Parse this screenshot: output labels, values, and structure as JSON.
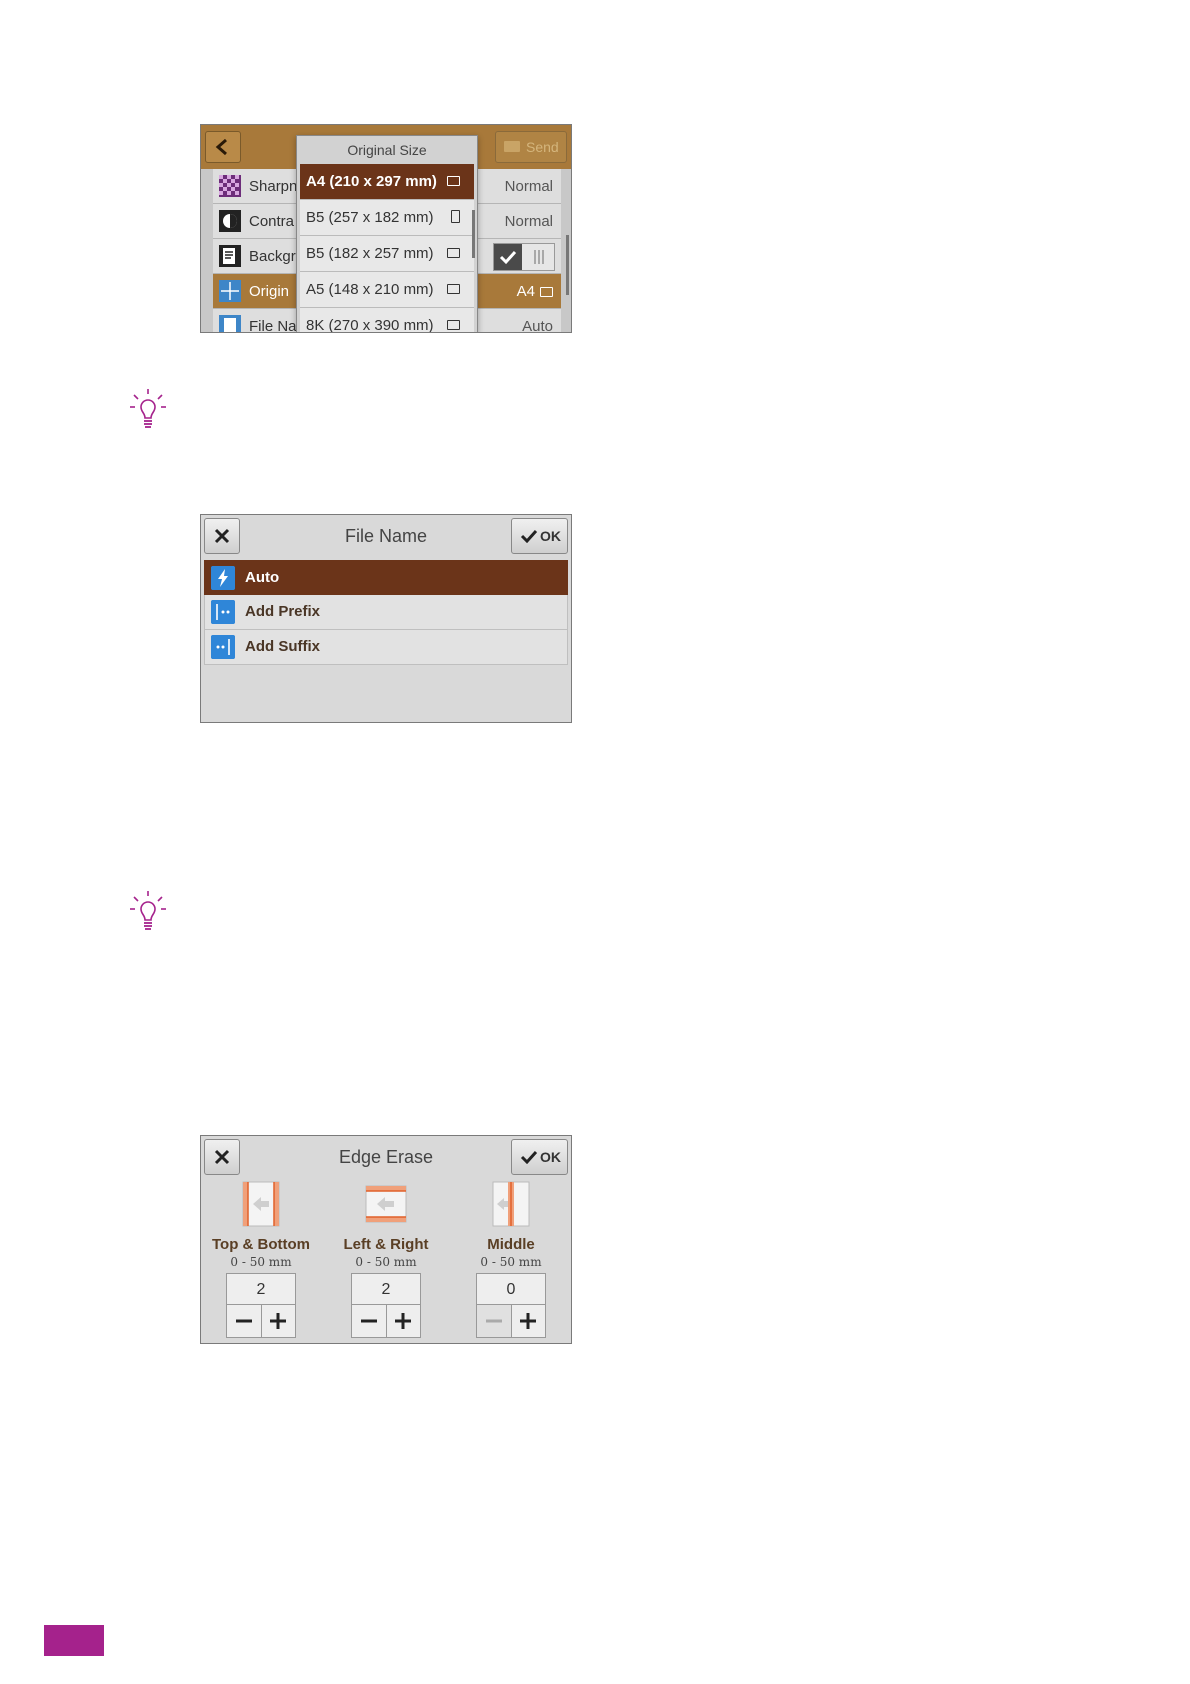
{
  "original_size_screen": {
    "header": {
      "send_label": "Send"
    },
    "rows": [
      {
        "label": "Sharpn",
        "value": "Normal",
        "icon": "checker-icon"
      },
      {
        "label": "Contra",
        "value": "Normal",
        "icon": "contrast-icon"
      },
      {
        "label": "Backgr",
        "value": "",
        "icon": "document-icon"
      },
      {
        "label": "Origin",
        "value": "A4",
        "icon": "crop-icon"
      },
      {
        "label": "File Name",
        "value": "Auto",
        "icon": "file-icon"
      }
    ],
    "popup": {
      "title": "Original Size",
      "options": [
        {
          "label": "A4 (210 x 297 mm)",
          "orientation": "landscape"
        },
        {
          "label": "B5 (257 x 182 mm)",
          "orientation": "portrait"
        },
        {
          "label": "B5 (182 x 257 mm)",
          "orientation": "landscape"
        },
        {
          "label": "A5 (148 x 210 mm)",
          "orientation": "landscape"
        },
        {
          "label": "8K (270 x 390 mm)",
          "orientation": "landscape"
        }
      ]
    }
  },
  "file_name_screen": {
    "title": "File Name",
    "ok_label": "OK",
    "items": [
      {
        "label": "Auto"
      },
      {
        "label": "Add Prefix"
      },
      {
        "label": "Add Suffix"
      }
    ]
  },
  "edge_erase_screen": {
    "title": "Edge Erase",
    "ok_label": "OK",
    "columns": [
      {
        "name": "Top & Bottom",
        "range": "0 - 50 mm",
        "value": "2"
      },
      {
        "name": "Left & Right",
        "range": "0 - 50 mm",
        "value": "2"
      },
      {
        "name": "Middle",
        "range": "0 - 50 mm",
        "value": "0"
      }
    ]
  },
  "colors": {
    "accent_brown": "#6b3419",
    "header_gold": "#a8793a",
    "tip_purple": "#a5228c",
    "icon_blue": "#2f86d8"
  }
}
